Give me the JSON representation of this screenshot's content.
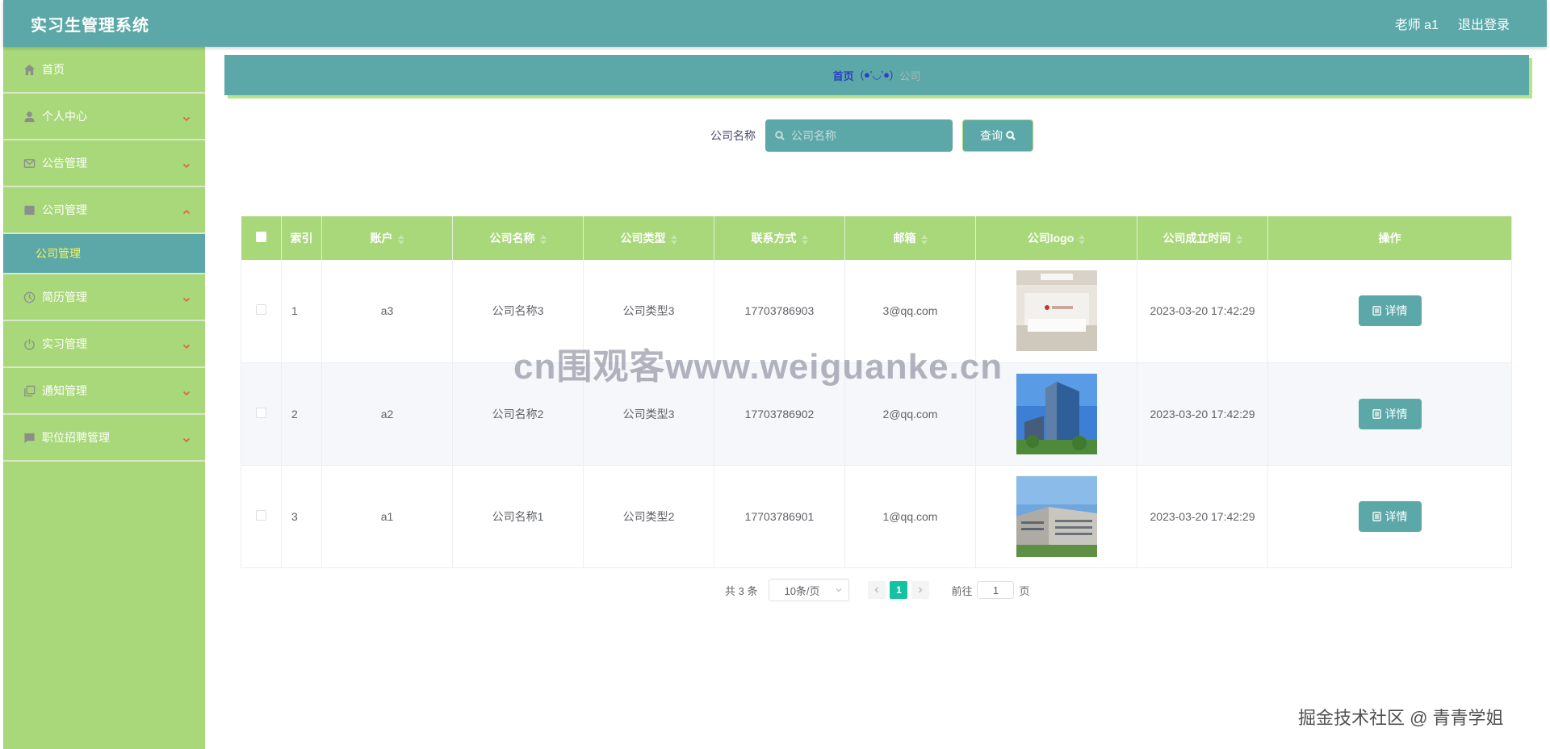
{
  "header": {
    "title": "实习生管理系统",
    "user_label": "老师 a1",
    "logout_label": "退出登录"
  },
  "sidebar": {
    "items": [
      {
        "label": "首页",
        "icon": "home-icon"
      },
      {
        "label": "个人中心",
        "icon": "user-icon"
      },
      {
        "label": "公告管理",
        "icon": "mail-icon"
      },
      {
        "label": "公司管理",
        "icon": "folder-icon",
        "expanded": true,
        "sub": "公司管理"
      },
      {
        "label": "简历管理",
        "icon": "clock-icon"
      },
      {
        "label": "实习管理",
        "icon": "power-icon"
      },
      {
        "label": "通知管理",
        "icon": "copy-icon"
      },
      {
        "label": "职位招聘管理",
        "icon": "chat-icon"
      }
    ]
  },
  "breadcrumb": {
    "home": "首页",
    "separator": "(●'◡'●)",
    "current": "公司"
  },
  "search": {
    "label": "公司名称",
    "placeholder": "公司名称",
    "button": "查询"
  },
  "table": {
    "headers": [
      "索引",
      "账户",
      "公司名称",
      "公司类型",
      "联系方式",
      "邮箱",
      "公司logo",
      "公司成立时间",
      "操作"
    ],
    "rows": [
      {
        "index": "1",
        "account": "a3",
        "name": "公司名称3",
        "type": "公司类型3",
        "phone": "17703786903",
        "email": "3@qq.com",
        "logo": "office-reception-photo",
        "time": "2023-03-20 17:42:29",
        "action": "详情"
      },
      {
        "index": "2",
        "account": "a2",
        "name": "公司名称2",
        "type": "公司类型3",
        "phone": "17703786902",
        "email": "2@qq.com",
        "logo": "glass-tower-photo",
        "time": "2023-03-20 17:42:29",
        "action": "详情"
      },
      {
        "index": "3",
        "account": "a1",
        "name": "公司名称1",
        "type": "公司类型2",
        "phone": "17703786901",
        "email": "1@qq.com",
        "logo": "campus-building-photo",
        "time": "2023-03-20 17:42:29",
        "action": "详情"
      }
    ]
  },
  "pagination": {
    "total": "共 3 条",
    "page_size": "10条/页",
    "current_page": "1",
    "goto_prefix": "前往",
    "goto_value": "1",
    "goto_suffix": "页"
  },
  "watermarks": {
    "center": "cn围观客www.weiguanke.cn",
    "corner": "掘金技术社区 @ 青青学姐"
  },
  "colors": {
    "primary": "#5ca8a8",
    "sidebar": "#a8d879",
    "active_page": "#13c2a3",
    "submenu_text": "#fff35a"
  }
}
